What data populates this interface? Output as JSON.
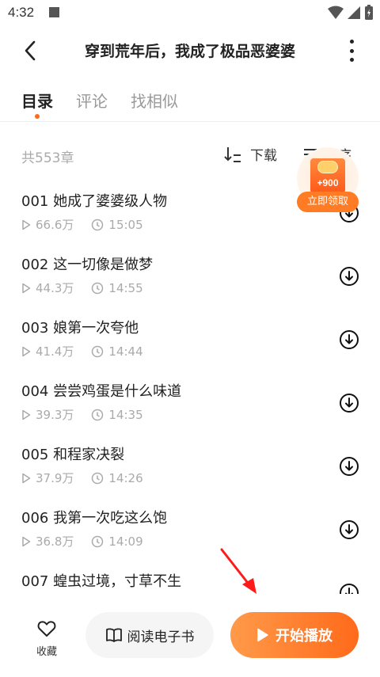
{
  "status_bar": {
    "time": "4:32"
  },
  "header": {
    "title": "穿到荒年后，我成了极品恶婆婆"
  },
  "tabs": [
    {
      "label": "目录",
      "active": true
    },
    {
      "label": "评论",
      "active": false
    },
    {
      "label": "找相似",
      "active": false
    }
  ],
  "chapter_bar": {
    "count": "共553章",
    "download_label": "下载",
    "sort_label": "倒序"
  },
  "chapters": [
    {
      "title": "001 她成了婆婆级人物",
      "plays": "66.6万",
      "duration": "15:05"
    },
    {
      "title": "002 这一切像是做梦",
      "plays": "44.3万",
      "duration": "14:55"
    },
    {
      "title": "003 娘第一次夸他",
      "plays": "41.4万",
      "duration": "14:44"
    },
    {
      "title": "004 尝尝鸡蛋是什么味道",
      "plays": "39.3万",
      "duration": "14:35"
    },
    {
      "title": "005 和程家决裂",
      "plays": "37.9万",
      "duration": "14:26"
    },
    {
      "title": "006 我第一次吃这么饱",
      "plays": "36.8万",
      "duration": "14:09"
    },
    {
      "title": "007 蝗虫过境，寸草不生",
      "plays": "",
      "duration": ""
    }
  ],
  "reward": {
    "amount": "+900",
    "label": "立即领取"
  },
  "bottom_bar": {
    "fav_label": "收藏",
    "ebook_label": "阅读电子书",
    "play_label": "开始播放"
  },
  "colors": {
    "accent": "#ff6a1a",
    "annotation": "#ff1a1a"
  }
}
